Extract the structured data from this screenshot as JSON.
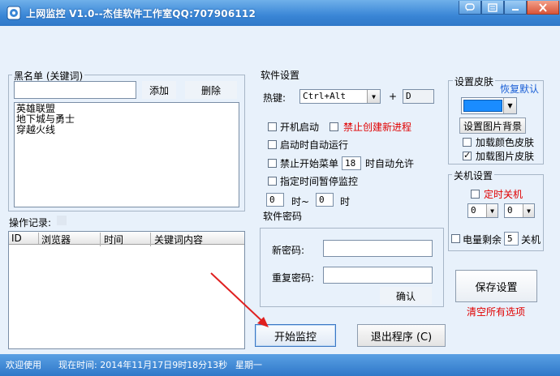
{
  "window": {
    "title": "上网监控 V1.0--杰佳软件工作室QQ:707906112"
  },
  "blacklist": {
    "legend": "黑名单 (关键词)",
    "input_value": "",
    "add_label": "添加",
    "delete_label": "删除",
    "items": [
      "英雄联盟",
      "地下城与勇士",
      "穿越火线"
    ]
  },
  "log": {
    "legend": "操作记录:",
    "columns": [
      "ID",
      "浏览器",
      "时间",
      "关键词内容"
    ]
  },
  "settings": {
    "legend": "软件设置",
    "hotkey_label": "热键:",
    "hotkey_value": "Ctrl+Alt",
    "plus": "+",
    "hotkey_key": "D",
    "autostart_label": "开机启动",
    "block_new_process_label": "禁止创建新进程",
    "auto_run_label": "启动时自动运行",
    "block_start_menu_label": "禁止开始菜单",
    "start_menu_minutes": "18",
    "start_menu_suffix": "时自动允许",
    "pause_monitor_label": "指定时间暂停监控",
    "pause_from": "0",
    "pause_from_suffix": "时~",
    "pause_to": "0",
    "pause_to_suffix": "时"
  },
  "password": {
    "legend": "软件密码",
    "new_label": "新密码:",
    "new_value": "",
    "repeat_label": "重复密码:",
    "repeat_value": "",
    "confirm_label": "确认"
  },
  "skin": {
    "legend": "设置皮肤",
    "restore_label": "恢复默认",
    "color": "#1a8cff",
    "set_image_label": "设置图片背景",
    "load_color_label": "加载颜色皮肤",
    "load_image_label": "加载图片皮肤"
  },
  "shutdown": {
    "legend": "关机设置",
    "timer_label": "定时关机",
    "hour_value": "0",
    "minute_value": "0",
    "battery_label": "电量剩余",
    "battery_value": "5",
    "battery_suffix": "关机"
  },
  "actions": {
    "save_label": "保存设置",
    "clear_label": "清空所有选项",
    "start_label": "开始监控",
    "exit_label": "退出程序 (C)"
  },
  "status": {
    "welcome": "欢迎使用",
    "time_text": "现在时间: 2014年11月17日9时18分13秒",
    "weekday": "星期一"
  },
  "colors": {
    "accent": "#2f78c8",
    "red_text": "#e00000",
    "arrow": "#e02020"
  }
}
